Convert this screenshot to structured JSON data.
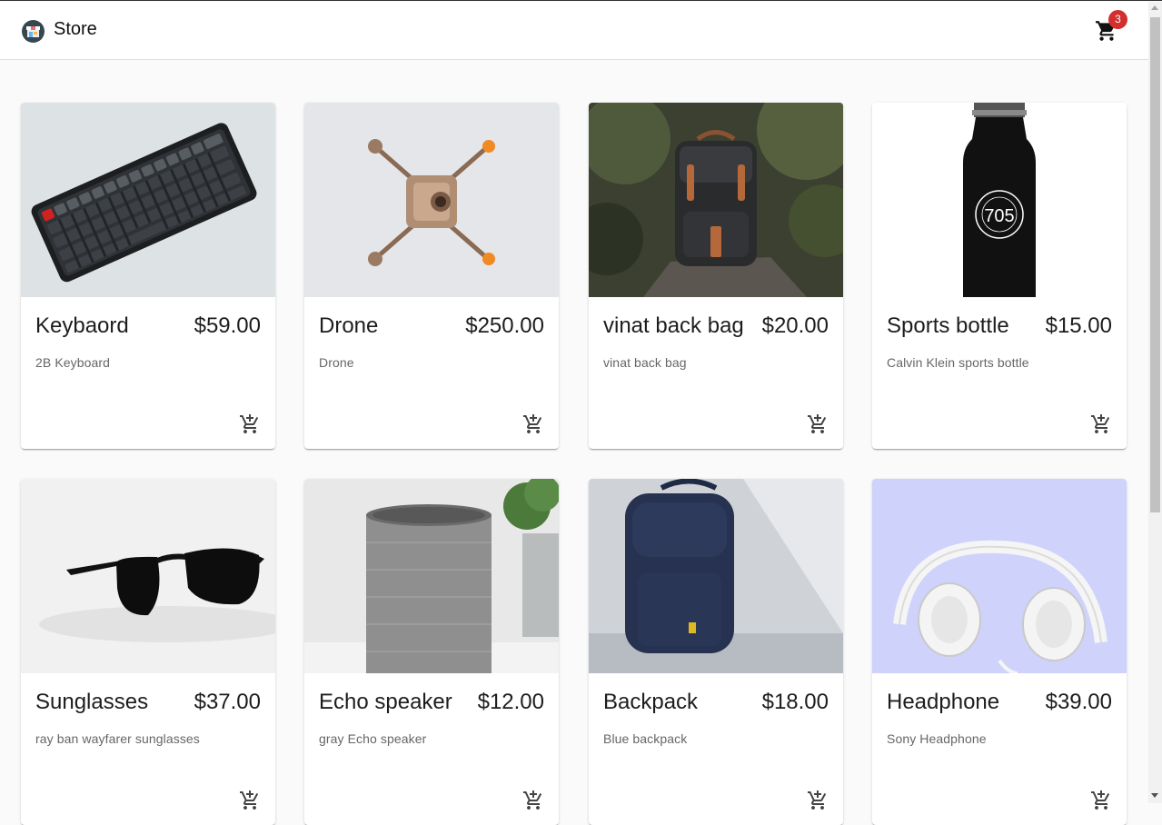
{
  "header": {
    "title": "Store",
    "logo_icon": "store-icon",
    "cart_icon": "shopping-cart-icon",
    "cart_count": "3"
  },
  "products": [
    {
      "name": "Keybaord",
      "price": "$59.00",
      "description": "2B Keyboard",
      "image": "keyboard"
    },
    {
      "name": "Drone",
      "price": "$250.00",
      "description": "Drone",
      "image": "drone"
    },
    {
      "name": "vinat back bag",
      "price": "$20.00",
      "description": "vinat back bag",
      "image": "vintage-backpack"
    },
    {
      "name": "Sports bottle",
      "price": "$15.00",
      "description": "Calvin Klein sports bottle",
      "image": "bottle",
      "image_text": "705"
    },
    {
      "name": "Sunglasses",
      "price": "$37.00",
      "description": "ray ban wayfarer sunglasses",
      "image": "sunglasses"
    },
    {
      "name": "Echo speaker",
      "price": "$12.00",
      "description": "gray Echo speaker",
      "image": "smart-speaker"
    },
    {
      "name": "Backpack",
      "price": "$18.00",
      "description": "Blue backpack",
      "image": "blue-backpack"
    },
    {
      "name": "Headphone",
      "price": "$39.00",
      "description": "Sony Headphone",
      "image": "headphones"
    }
  ],
  "add_to_cart_icon": "add-shopping-cart-icon",
  "colors": {
    "badge": "#d32f2f",
    "background": "#fafafa"
  }
}
